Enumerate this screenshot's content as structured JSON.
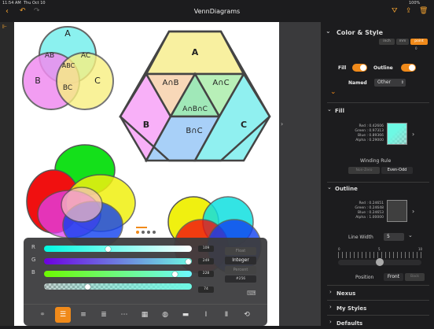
{
  "status": {
    "time": "11:54 AM",
    "date": "Thu Oct 10",
    "battery": "100%"
  },
  "app": {
    "title": "VennDiagrams"
  },
  "canvas": {
    "venn3": {
      "labels": [
        "A",
        "AB",
        "AC",
        "ABC",
        "B",
        "BC",
        "C"
      ]
    },
    "hex": {
      "labels": [
        "A",
        "A∩B",
        "A∩C",
        "A∩B∩C",
        "B",
        "B∩C",
        "C"
      ]
    }
  },
  "picker": {
    "rows": [
      {
        "label": "R",
        "value": "109",
        "fraction": 0.43
      },
      {
        "label": "G",
        "value": "249",
        "fraction": 0.98
      },
      {
        "label": "B",
        "value": "228",
        "fraction": 0.89
      },
      {
        "label": "",
        "value": "74",
        "fraction": 0.29
      }
    ],
    "modes": [
      "Float",
      "Integer",
      "Percent"
    ],
    "hex_label": "#256"
  },
  "panel": {
    "header": "Color & Style",
    "units": [
      "inch",
      "mm",
      "point"
    ],
    "unit_value": "0",
    "fill_label": "Fill",
    "outline_label": "Outline",
    "named_label": "Named",
    "named_value": "Other",
    "fill_section": "Fill",
    "fill_values": {
      "red": "Red : 0.42606",
      "green": "Green : 0.97313",
      "blue": "Blue : 0.89366",
      "alpha": "Alpha : 0.29000"
    },
    "winding_label": "Winding Rule",
    "winding_options": [
      "Non-Zero",
      "Even-Odd"
    ],
    "outline_section": "Outline",
    "outline_values": {
      "red": "Red : 0.24651",
      "green": "Green : 0.24648",
      "blue": "Blue : 0.24653",
      "alpha": "Alpha : 1.00000"
    },
    "line_width_label": "Line Width",
    "line_width_value": "5",
    "ruler": [
      "0",
      "5",
      "10"
    ],
    "position_label": "Position",
    "position_options": [
      "Front",
      "Back"
    ],
    "sections": [
      "Nexus",
      "My Styles",
      "Defaults"
    ]
  },
  "colors": {
    "accent": "#f08a1a"
  }
}
